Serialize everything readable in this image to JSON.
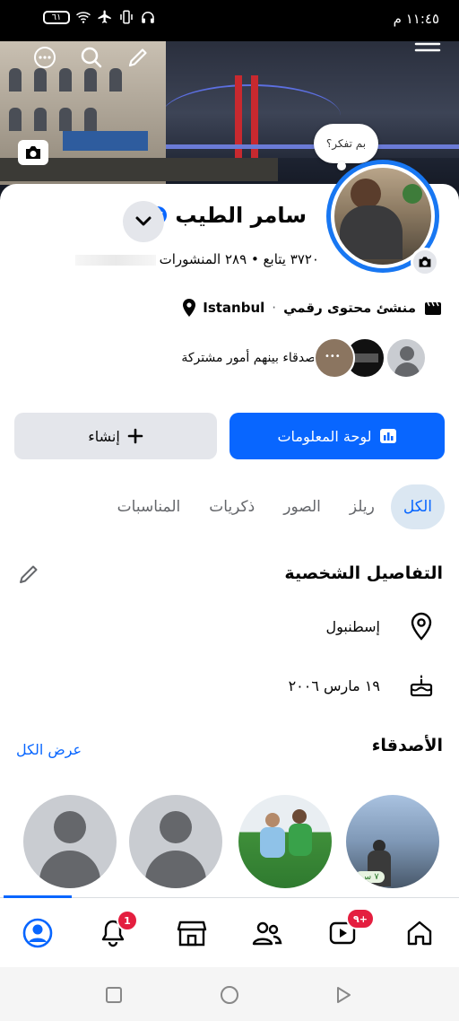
{
  "status_bar": {
    "time": "١١:٤٥ م",
    "battery": "٦١"
  },
  "cover": {},
  "thought_bubble": "بم تفكر؟",
  "profile": {
    "name": "سامر الطيب",
    "followers_count": "٣٧٢٠ ، ",
    "stats_tail": "٣٧٢٠ يتابع • ٢٨٩ المنشورات",
    "job": "منشئ محتوى رقمي",
    "location": "Istanbul",
    "mutual_text": "أصدقاء بينهم أمور مشتركة",
    "mutual_more": "•••"
  },
  "actions": {
    "primary": "لوحة المعلومات",
    "secondary": "إنشاء"
  },
  "tabs": [
    {
      "label": "الكل"
    },
    {
      "label": "ريلز"
    },
    {
      "label": "الصور"
    },
    {
      "label": "ذكريات"
    },
    {
      "label": "المناسبات"
    }
  ],
  "personal_details": {
    "title": "التفاصيل الشخصية",
    "city": "إسطنبول",
    "birthday": "١٩ مارس ٢٠٠٦"
  },
  "friends": {
    "title": "الأصدقاء",
    "see_all": "عرض الكل",
    "first_ago": "٧ س"
  },
  "navbar": {
    "notifications_badge": "1",
    "video_badge": "٩+"
  },
  "colors": {
    "accent": "#0866ff",
    "badge": "#e41e3f"
  }
}
